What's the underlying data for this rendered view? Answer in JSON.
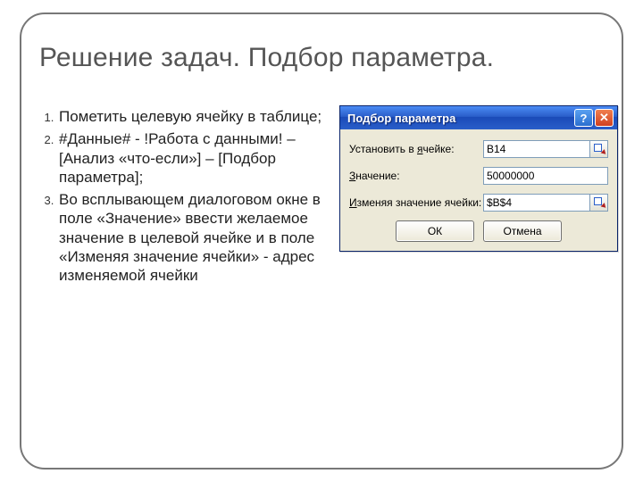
{
  "title": "Решение задач. Подбор параметра.",
  "steps": {
    "s1": "Пометить целевую ячейку в таблице;",
    "s2": "#Данные# - !Работа с данными! – [Анализ «что-если»] – [Подбор параметра];",
    "s3": "Во всплывающем диалоговом окне в поле «Значение» ввести желаемое значение в целевой ячейке и в поле «Изменяя значение ячейки» - адрес изменяемой ячейки"
  },
  "dialog": {
    "title": "Подбор параметра",
    "help_glyph": "?",
    "close_glyph": "✕",
    "labels": {
      "set_cell_pre": "Установить в ",
      "set_cell_ul": "я",
      "set_cell_post": "чейке:",
      "value_ul": "З",
      "value_post": "начение:",
      "change_ul": "И",
      "change_post": "зменяя значение ячейки:"
    },
    "values": {
      "set_cell": "B14",
      "value": "50000000",
      "change": "$B$4"
    },
    "buttons": {
      "ok": "ОК",
      "cancel": "Отмена"
    }
  }
}
